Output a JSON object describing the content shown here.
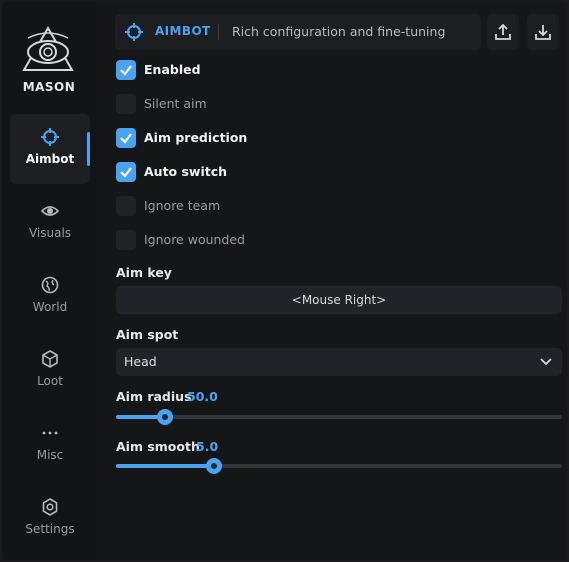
{
  "brand": {
    "name": "MASON"
  },
  "nav": {
    "aimbot": "Aimbot",
    "visuals": "Visuals",
    "world": "World",
    "loot": "Loot",
    "misc": "Misc",
    "settings": "Settings",
    "active": "aimbot"
  },
  "header": {
    "title": "AIMBOT",
    "subtitle": "Rich configuration and fine-tuning"
  },
  "options": [
    {
      "label": "Enabled",
      "checked": true
    },
    {
      "label": "Silent aim",
      "checked": false
    },
    {
      "label": "Aim prediction",
      "checked": true
    },
    {
      "label": "Auto switch",
      "checked": true
    },
    {
      "label": "Ignore team",
      "checked": false
    },
    {
      "label": "Ignore wounded",
      "checked": false
    }
  ],
  "aim_key": {
    "label": "Aim key",
    "value": "<Mouse Right>"
  },
  "aim_spot": {
    "label": "Aim spot",
    "value": "Head"
  },
  "aim_radius": {
    "label": "Aim radius",
    "value": "50.0",
    "fraction": 0.11
  },
  "aim_smooth": {
    "label": "Aim smooth",
    "value": "5.0",
    "fraction": 0.22
  },
  "colors": {
    "accent": "#4aa3f0",
    "background": "#151618",
    "panel": "#212328"
  }
}
